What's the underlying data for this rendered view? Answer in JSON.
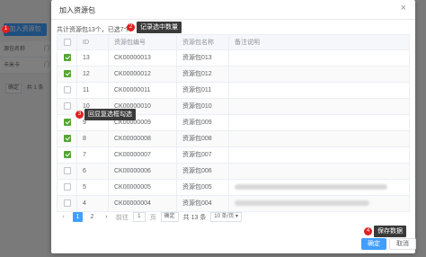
{
  "background": {
    "add_button": "加入资源包",
    "table_header": "源包名称",
    "table_header_edge": "门",
    "row_text": "卡米卡",
    "row_edge": "门",
    "pager_go": "确定",
    "pager_total": "共 1 条"
  },
  "dialog": {
    "title": "加入资源包",
    "close_icon": "close-icon",
    "summary": "共计资源包13个，已选7个",
    "columns": [
      "ID",
      "资源包编号",
      "资源包名称",
      "备注说明"
    ],
    "rows": [
      {
        "id": "13",
        "code": "CK00000013",
        "name": "资源包013",
        "checked": true,
        "desc_blur": 0
      },
      {
        "id": "12",
        "code": "CK00000012",
        "name": "资源包012",
        "checked": true,
        "desc_blur": 0
      },
      {
        "id": "11",
        "code": "CK00000011",
        "name": "资源包011",
        "checked": false,
        "desc_blur": 0
      },
      {
        "id": "10",
        "code": "CK00000010",
        "name": "资源包010",
        "checked": false,
        "desc_blur": 0
      },
      {
        "id": "9",
        "code": "CK00000009",
        "name": "资源包009",
        "checked": true,
        "desc_blur": 0
      },
      {
        "id": "8",
        "code": "CK00000008",
        "name": "资源包008",
        "checked": true,
        "desc_blur": 0
      },
      {
        "id": "7",
        "code": "CK00000007",
        "name": "资源包007",
        "checked": true,
        "desc_blur": 0
      },
      {
        "id": "6",
        "code": "CK00000006",
        "name": "资源包006",
        "checked": false,
        "desc_blur": 0
      },
      {
        "id": "5",
        "code": "CK00000005",
        "name": "资源包005",
        "checked": false,
        "desc_blur": 1
      },
      {
        "id": "4",
        "code": "CK00000004",
        "name": "资源包004",
        "checked": false,
        "desc_blur": 1
      }
    ],
    "pagination": {
      "prev_icon": "chevron-left-icon",
      "pages": [
        "1",
        "2"
      ],
      "current_page": "1",
      "next_icon": "chevron-right-icon",
      "goto_label": "前往",
      "goto_value": "1",
      "go_button": "确定",
      "total": "共 13 条",
      "page_size": "10 条/页 ▾"
    },
    "ok_button": "确定",
    "cancel_button": "取消"
  },
  "annotations": [
    {
      "number": "1",
      "label": ""
    },
    {
      "number": "2",
      "label": "记录选中数量"
    },
    {
      "number": "3",
      "label": "回显复选框勾选"
    },
    {
      "number": "4",
      "label": "保存数据"
    }
  ],
  "colors": {
    "primary": "#409eff",
    "checked": "#55a532",
    "marker": "#e02020",
    "tag_bg": "#3a3a3a"
  }
}
